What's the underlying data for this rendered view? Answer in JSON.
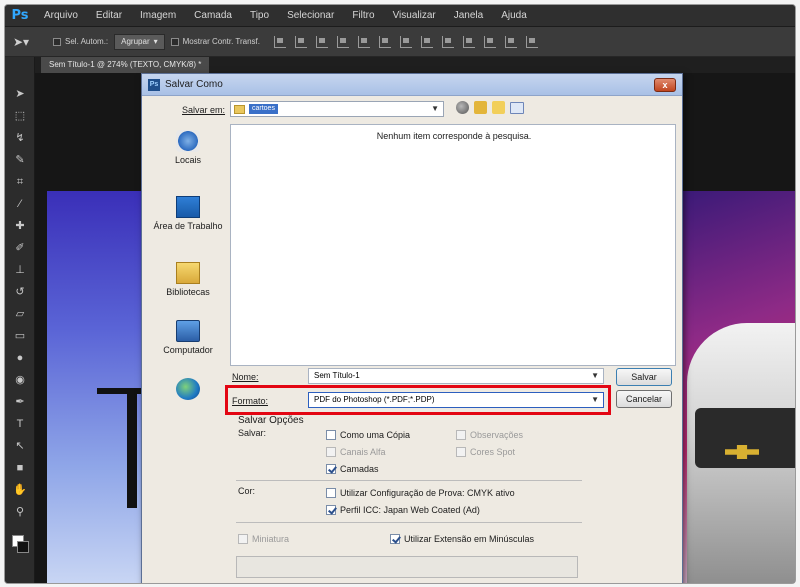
{
  "app": {
    "logo": "Ps",
    "menu": [
      "Arquivo",
      "Editar",
      "Imagem",
      "Camada",
      "Tipo",
      "Selecionar",
      "Filtro",
      "Visualizar",
      "Janela",
      "Ajuda"
    ]
  },
  "options_bar": {
    "auto_select_label": "Sel. Autom.:",
    "group_value": "Agrupar",
    "show_transform_label": "Mostrar Contr. Transf."
  },
  "document_tab": {
    "label": "Sem Título-1 @ 274% (TEXTO, CMYK/8) *"
  },
  "dialog": {
    "title": "Salvar Como",
    "close_label": "x",
    "save_in_label": "Salvar em:",
    "save_in_value": "cartoes",
    "empty_message": "Nenhum item corresponde à pesquisa.",
    "places": [
      {
        "label": "Locais",
        "icon": "recent-places-icon"
      },
      {
        "label": "Área de Trabalho",
        "icon": "desktop-icon"
      },
      {
        "label": "Bibliotecas",
        "icon": "libraries-icon"
      },
      {
        "label": "Computador",
        "icon": "computer-icon"
      },
      {
        "label": "",
        "icon": "network-icon"
      }
    ],
    "name_label": "Nome:",
    "name_value": "Sem Título-1",
    "format_label": "Formato:",
    "format_value": "PDF do Photoshop (*.PDF;*.PDP)",
    "save_button": "Salvar",
    "cancel_button": "Cancelar",
    "save_options_title": "Salvar Opções",
    "save_label": "Salvar:",
    "options": {
      "as_copy": {
        "label": "Como uma Cópia",
        "checked": false,
        "enabled": true
      },
      "notes": {
        "label": "Observações",
        "checked": false,
        "enabled": false
      },
      "alpha_channels": {
        "label": "Canais Alfa",
        "checked": false,
        "enabled": false
      },
      "spot_colors": {
        "label": "Cores Spot",
        "checked": false,
        "enabled": false
      },
      "layers": {
        "label": "Camadas",
        "checked": true,
        "enabled": true
      }
    },
    "color_label": "Cor:",
    "color_options": {
      "proof_setup": {
        "label": "Utilizar Configuração de Prova: CMYK ativo",
        "checked": false
      },
      "icc_profile": {
        "label": "Perfil ICC: Japan Web Coated (Ad)",
        "checked": true
      }
    },
    "thumbnail": {
      "label": "Miniatura",
      "checked": false,
      "enabled": false
    },
    "lowercase_ext": {
      "label": "Utilizar Extensão em Minúsculas",
      "checked": true
    }
  }
}
